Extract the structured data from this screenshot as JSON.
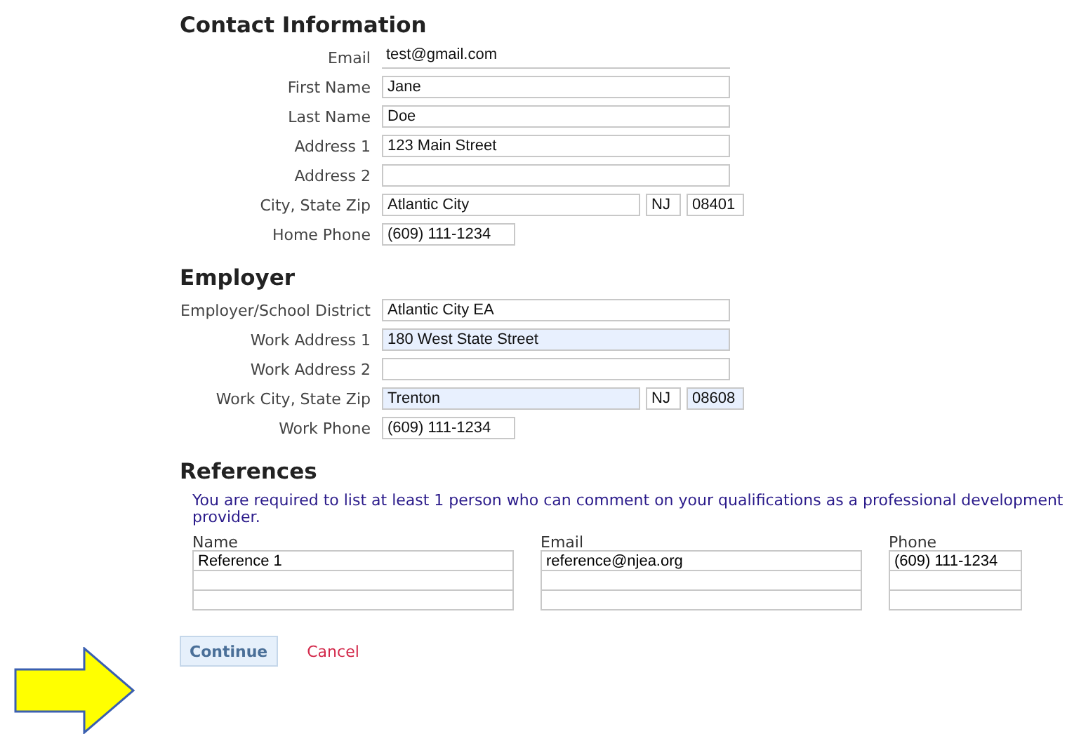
{
  "sections": [
    {
      "title": "Contact Information",
      "rows": [
        {
          "label": "Email",
          "inputs": [
            {
              "kind": "static",
              "value": "test@gmail.com",
              "highlighted": false
            }
          ]
        },
        {
          "label": "First Name",
          "inputs": [
            {
              "kind": "text",
              "value": "Jane",
              "highlighted": false
            }
          ]
        },
        {
          "label": "Last Name",
          "inputs": [
            {
              "kind": "text",
              "value": "Doe",
              "highlighted": false
            }
          ]
        },
        {
          "label": "Address 1",
          "inputs": [
            {
              "kind": "text",
              "value": "123 Main Street",
              "highlighted": false
            }
          ]
        },
        {
          "label": "Address 2",
          "inputs": [
            {
              "kind": "text",
              "highlighted": false
            }
          ]
        },
        {
          "label": "City, State Zip",
          "inputs": [
            {
              "kind": "city",
              "value": "Atlantic City",
              "highlighted": false
            },
            {
              "kind": "state",
              "value": "NJ",
              "highlighted": false
            },
            {
              "kind": "zip",
              "value": "08401",
              "highlighted": false
            }
          ]
        },
        {
          "label": "Home Phone",
          "inputs": [
            {
              "kind": "phone",
              "value": "(609) 111-1234",
              "highlighted": false
            }
          ]
        }
      ]
    },
    {
      "title": "Employer",
      "rows": [
        {
          "label": "Employer/School District",
          "inputs": [
            {
              "kind": "text",
              "value": "Atlantic City EA",
              "highlighted": false
            }
          ]
        },
        {
          "label": "Work Address 1",
          "inputs": [
            {
              "kind": "text",
              "value": "180 West State Street",
              "highlighted": true
            }
          ]
        },
        {
          "label": "Work Address 2",
          "inputs": [
            {
              "kind": "text",
              "highlighted": false
            }
          ]
        },
        {
          "label": "Work City, State Zip",
          "inputs": [
            {
              "kind": "city",
              "value": "Trenton",
              "highlighted": true
            },
            {
              "kind": "state",
              "value": "NJ",
              "highlighted": false
            },
            {
              "kind": "zip",
              "value": "08608",
              "highlighted": true
            }
          ]
        },
        {
          "label": "Work Phone",
          "inputs": [
            {
              "kind": "phone",
              "value": "(609) 111-1234",
              "highlighted": false
            }
          ]
        }
      ]
    }
  ],
  "references": {
    "title": "References",
    "note": "You are required to list at least 1 person who can comment on your qualifications as a professional development provider.",
    "columns": [
      "Name",
      "Email",
      "Phone"
    ],
    "rows": [
      [
        "Reference 1",
        "reference@njea.org",
        "(609) 111-1234"
      ],
      [
        "",
        "",
        ""
      ],
      [
        "",
        "",
        ""
      ]
    ]
  },
  "buttons": {
    "continue": "Continue",
    "cancel": "Cancel"
  }
}
